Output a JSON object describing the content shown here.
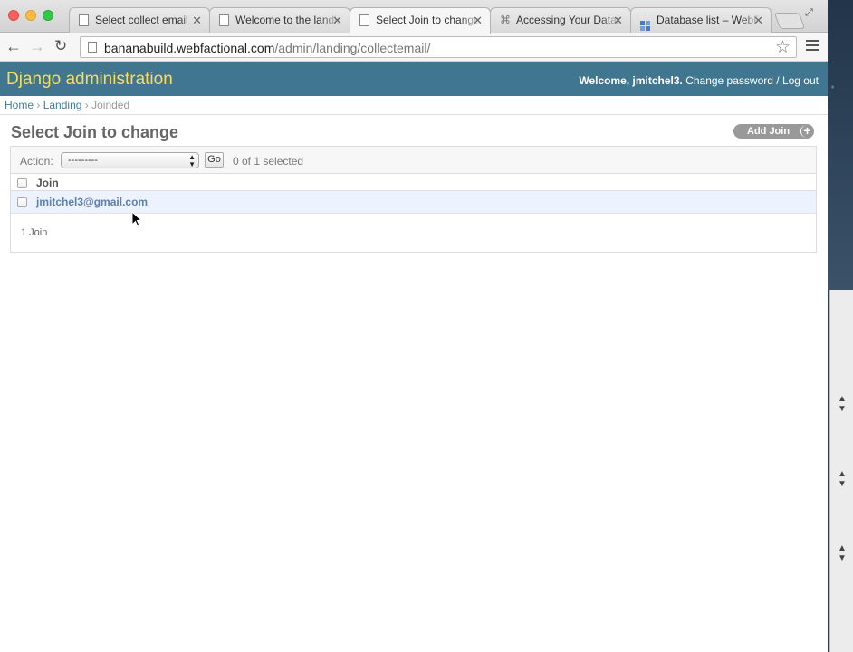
{
  "browser": {
    "tabs": [
      {
        "title": "Select collect email",
        "icon": "page-icon"
      },
      {
        "title": "Welcome to the landing",
        "icon": "page-icon"
      },
      {
        "title": "Select Join to change",
        "icon": "page-icon",
        "active": true
      },
      {
        "title": "Accessing Your Database",
        "icon": "link-icon"
      },
      {
        "title": "Database list – WebFaction",
        "icon": "grid-icon"
      }
    ],
    "url_host": "bananabuild.webfactional.com",
    "url_path": "/admin/landing/collectemail/"
  },
  "admin": {
    "branding": "Django administration",
    "welcome": "Welcome,",
    "username": "jmitchel3",
    "change_password": "Change password",
    "separator": "/",
    "logout": "Log out"
  },
  "breadcrumbs": {
    "home": "Home",
    "app": "Landing",
    "current": "Joinded"
  },
  "content": {
    "title": "Select Join to change",
    "add_button": "Add Join",
    "action_label": "Action:",
    "action_selected": "---------",
    "go_label": "Go",
    "selected_count": "0 of 1 selected",
    "column_header": "Join",
    "rows": [
      {
        "value": "jmitchel3@gmail.com"
      }
    ],
    "paginator": "1 Join"
  },
  "colors": {
    "header_bg": "#417690",
    "branding": "#f5dd5d",
    "link": "#5b80b2",
    "row_highlight": "#edf3fe"
  }
}
